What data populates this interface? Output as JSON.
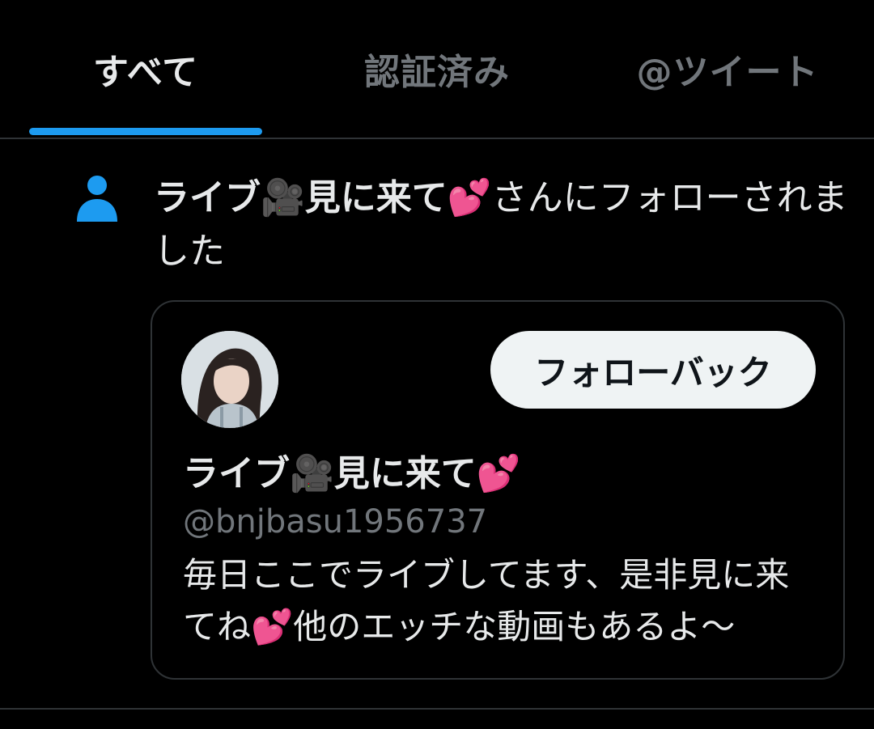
{
  "tabs": {
    "all": "すべて",
    "verified": "認証済み",
    "mentions": "@ツイート"
  },
  "notification": {
    "name": "ライブ🎥見に来て💕",
    "action": "さんにフォローされました",
    "icon": "person-icon"
  },
  "card": {
    "display_name": "ライブ🎥見に来て💕",
    "handle": "@bnjbasu1956737",
    "bio": "毎日ここでライブしてます、是非見に来てね💕他のエッチな動画もあるよ〜",
    "follow_back_label": "フォローバック"
  },
  "colors": {
    "background": "#000000",
    "accent": "#1d9bf0",
    "text_primary": "#e7e9ea",
    "text_secondary": "#71767b",
    "border": "#2f3336",
    "button_bg": "#eff3f4"
  }
}
